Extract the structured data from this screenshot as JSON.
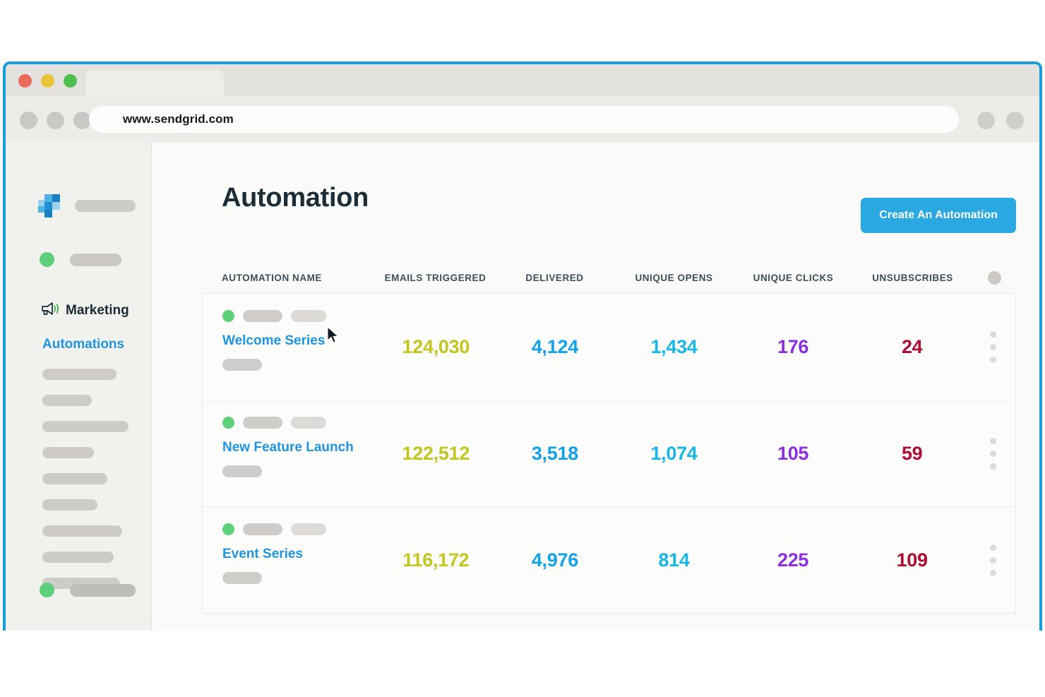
{
  "browser": {
    "url": "www.sendgrid.com",
    "traffic_lights": [
      "close",
      "minimize",
      "maximize"
    ]
  },
  "sidebar": {
    "marketing_label": "Marketing",
    "automations_label": "Automations",
    "nav_placeholder_widths": [
      105,
      70,
      122,
      73,
      92,
      78,
      113,
      101,
      110
    ]
  },
  "header": {
    "title": "Automation",
    "cta_label": "Create An Automation",
    "cta_color": "#2aa8e2"
  },
  "table": {
    "columns": [
      "AUTOMATION NAME",
      "EMAILS TRIGGERED",
      "DELIVERED",
      "UNIQUE OPENS",
      "UNIQUE CLICKS",
      "UNSUBSCRIBES"
    ],
    "column_colors": {
      "emails_triggered": "#c2c61e",
      "delivered": "#12a2e8",
      "unique_opens": "#18b6e8",
      "unique_clicks": "#8b2fe0",
      "unsubscribes": "#ad0c35"
    },
    "rows": [
      {
        "name": "Welcome Series",
        "status": "active",
        "emails_triggered": "124,030",
        "delivered": "4,124",
        "unique_opens": "1,434",
        "unique_clicks": "176",
        "unsubscribes": "24"
      },
      {
        "name": "New Feature Launch",
        "status": "active",
        "emails_triggered": "122,512",
        "delivered": "3,518",
        "unique_opens": "1,074",
        "unique_clicks": "105",
        "unsubscribes": "59"
      },
      {
        "name": "Event Series",
        "status": "active",
        "emails_triggered": "116,172",
        "delivered": "4,976",
        "unique_opens": "814",
        "unique_clicks": "225",
        "unsubscribes": "109"
      }
    ]
  }
}
